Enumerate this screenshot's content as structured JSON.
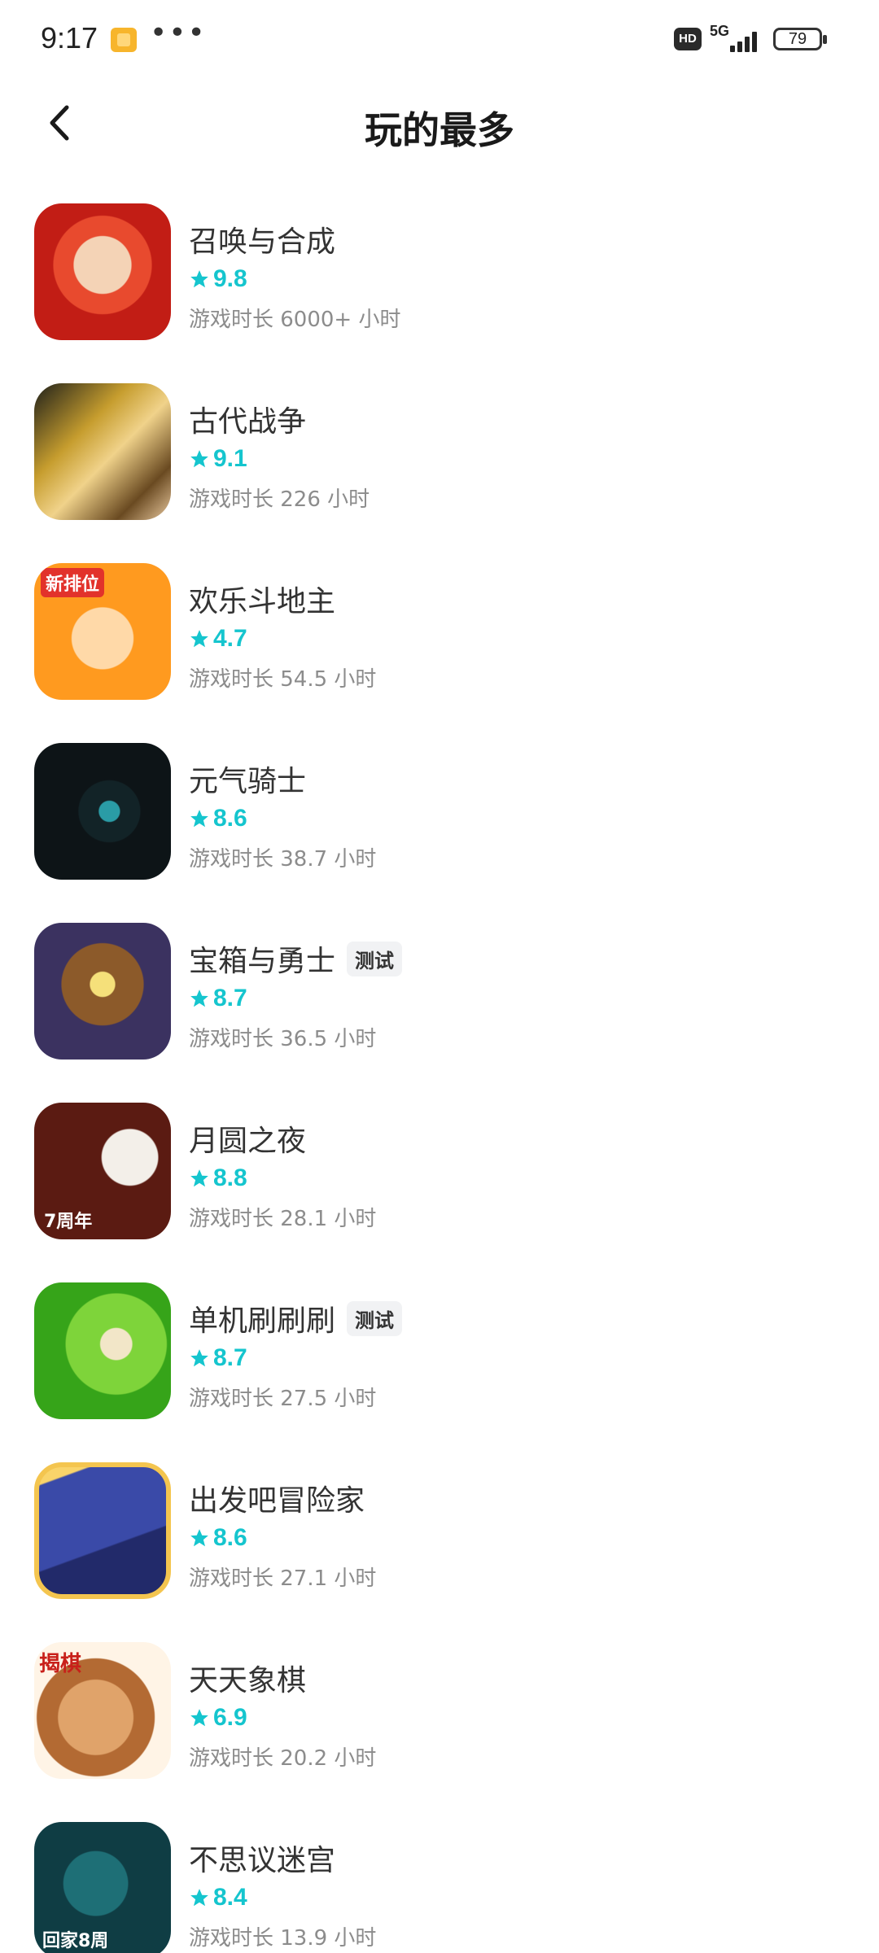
{
  "status_bar": {
    "time": "9:17",
    "more": "•••",
    "hd": "HD",
    "network": "5G",
    "battery": "79"
  },
  "header": {
    "title": "玩的最多"
  },
  "games": [
    {
      "name": "召唤与合成",
      "rating": "9.8",
      "playtime": "游戏时长 6000+ 小时",
      "tag": ""
    },
    {
      "name": "古代战争",
      "rating": "9.1",
      "playtime": "游戏时长 226 小时",
      "tag": ""
    },
    {
      "name": "欢乐斗地主",
      "rating": "4.7",
      "playtime": "游戏时长 54.5 小时",
      "tag": "",
      "icon_badge": "新排位"
    },
    {
      "name": "元气骑士",
      "rating": "8.6",
      "playtime": "游戏时长 38.7 小时",
      "tag": ""
    },
    {
      "name": "宝箱与勇士",
      "rating": "8.7",
      "playtime": "游戏时长 36.5 小时",
      "tag": "测试"
    },
    {
      "name": "月圆之夜",
      "rating": "8.8",
      "playtime": "游戏时长 28.1 小时",
      "tag": "",
      "icon_badge": "7周年"
    },
    {
      "name": "单机刷刷刷",
      "rating": "8.7",
      "playtime": "游戏时长 27.5 小时",
      "tag": "测试"
    },
    {
      "name": "出发吧冒险家",
      "rating": "8.6",
      "playtime": "游戏时长 27.1 小时",
      "tag": ""
    },
    {
      "name": "天天象棋",
      "rating": "6.9",
      "playtime": "游戏时长 20.2 小时",
      "tag": "",
      "icon_badge": "揭棋"
    },
    {
      "name": "不思议迷宫",
      "rating": "8.4",
      "playtime": "游戏时长 13.9 小时",
      "tag": "",
      "icon_badge": "回家8周"
    }
  ],
  "colors": {
    "rating": "#15c5ce",
    "playtime": "#8c8c8c",
    "tag_bg": "#f1f2f4"
  }
}
